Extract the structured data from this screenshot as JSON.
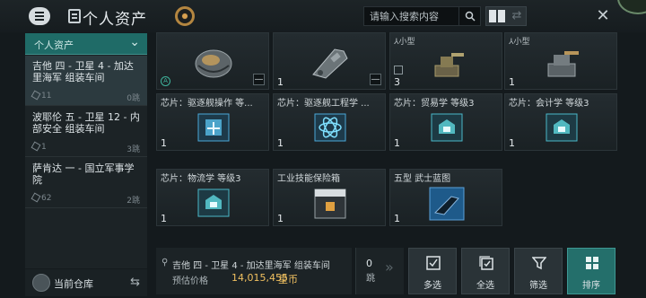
{
  "header": {
    "title": "个人资产",
    "search_placeholder": "请输入搜索内容"
  },
  "sidebar": {
    "filter_label": "个人资产",
    "locations": [
      {
        "name": "吉他 四 - 卫星 4 - 加达里海军 组装车间",
        "count": "11",
        "jumps": "0跳"
      },
      {
        "name": "波耶伦 五 - 卫星 12 - 内部安全 组装车间",
        "count": "1",
        "jumps": "3跳"
      },
      {
        "name": "萨肯达 一 - 国立军事学院",
        "count": "62",
        "jumps": "2跳"
      }
    ],
    "warehouse_label": "当前仓库"
  },
  "items": [
    {
      "name": "",
      "qty": "",
      "tag": "",
      "art": "capsule"
    },
    {
      "name": "",
      "qty": "1",
      "tag": "",
      "art": "ship"
    },
    {
      "name": "",
      "qty": "3",
      "tag": "小型",
      "art": "turret"
    },
    {
      "name": "",
      "qty": "1",
      "tag": "小型",
      "art": "turret2"
    },
    {
      "name": "芯片：驱逐舰操作 等...",
      "qty": "1",
      "tag": "",
      "art": "chip-blue"
    },
    {
      "name": "芯片：驱逐舰工程学 ...",
      "qty": "1",
      "tag": "",
      "art": "chip-atom"
    },
    {
      "name": "芯片：贸易学 等级3",
      "qty": "1",
      "tag": "",
      "art": "chip-teal"
    },
    {
      "name": "芯片：会计学 等级3",
      "qty": "1",
      "tag": "",
      "art": "chip-teal"
    },
    {
      "name": "芯片：物流学 等级3",
      "qty": "1",
      "tag": "",
      "art": "chip-teal"
    },
    {
      "name": "工业技能保险箱",
      "qty": "1",
      "tag": "",
      "art": "crate"
    },
    {
      "name": "五型 武士蓝图",
      "qty": "1",
      "tag": "",
      "art": "blueprint"
    }
  ],
  "bottom": {
    "location": "吉他 四 - 卫星 4 - 加达里海军 组装车间",
    "price_label": "预估价格",
    "price_value": "14,015,455",
    "price_unit": "星币",
    "jumps": "0",
    "jumps_unit": "跳"
  },
  "actions": {
    "multi_select": "多选",
    "select_all": "全选",
    "filter": "筛选",
    "sort": "排序"
  },
  "colors": {
    "accent": "#246f6b",
    "price": "#f0c060",
    "active_row": "#2c3a3f"
  }
}
